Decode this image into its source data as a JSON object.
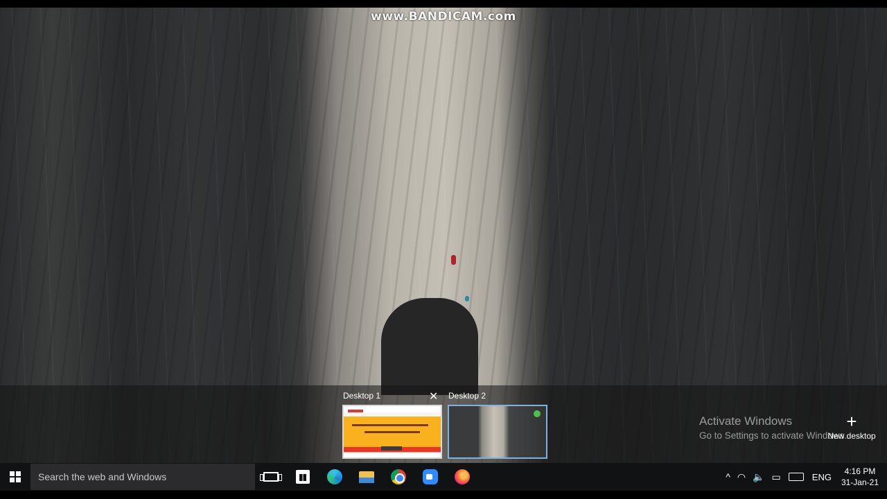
{
  "watermark": "www.BANDICAM.com",
  "task_view": {
    "desktops": [
      {
        "label": "Desktop 1",
        "close_glyph": "✕"
      },
      {
        "label": "Desktop 2"
      }
    ],
    "new_desktop": {
      "icon": "plus-icon",
      "glyph": "+",
      "label": "New desktop"
    }
  },
  "activation": {
    "title": "Activate Windows",
    "subtitle": "Go to Settings to activate Windows."
  },
  "taskbar": {
    "search_placeholder": "Search the web and Windows",
    "pinned_apps": [
      "task-view",
      "microsoft-store",
      "edge",
      "file-explorer",
      "chrome",
      "zoom",
      "firefox"
    ],
    "tray": {
      "chevron_glyph": "^",
      "wifi_glyph": "◠",
      "volume_glyph": "🔈",
      "notification_glyph": "▭",
      "language": "ENG",
      "time": "4:16 PM",
      "date": "31-Jan-21"
    }
  }
}
